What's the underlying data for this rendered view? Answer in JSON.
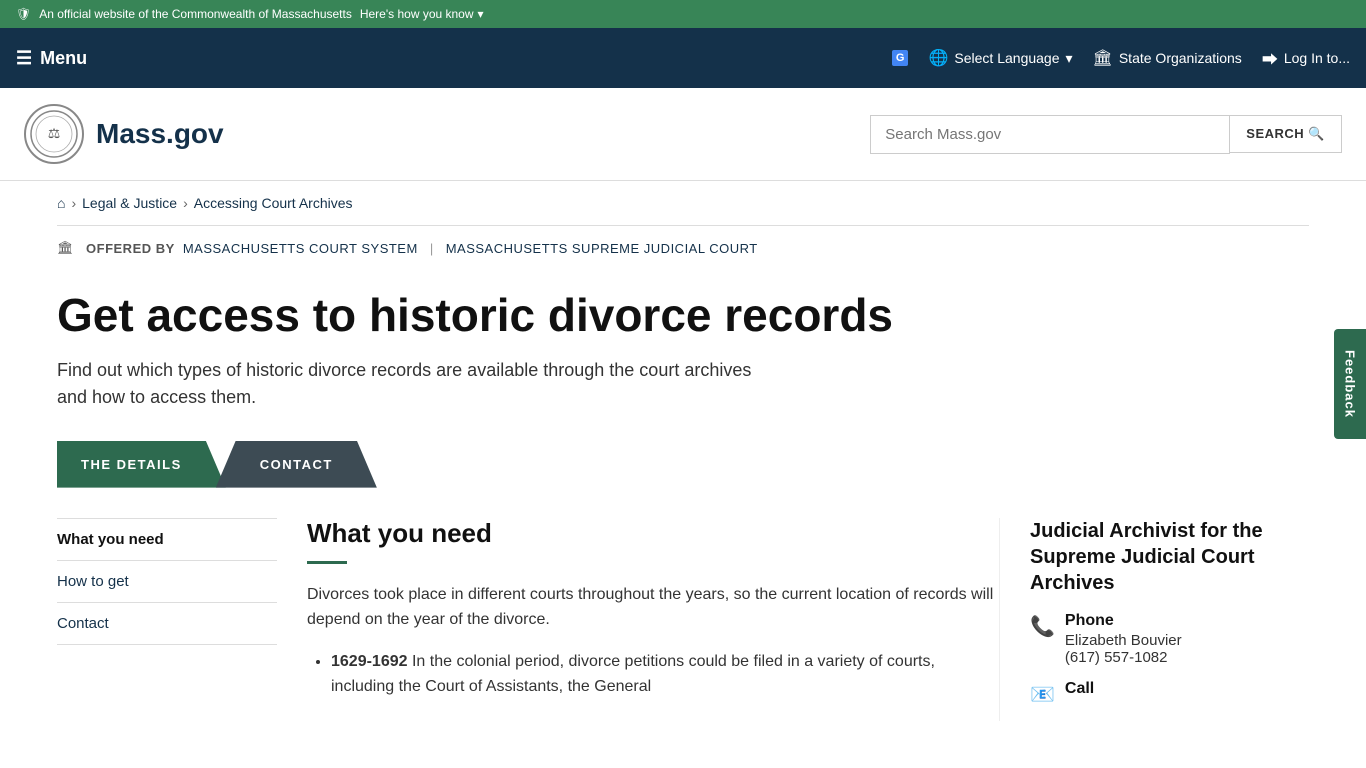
{
  "top_banner": {
    "text": "An official website of the Commonwealth of Massachusetts",
    "link_text": "Here's how you know",
    "shield": "🛡"
  },
  "nav": {
    "menu_label": "Menu",
    "hamburger": "☰",
    "translate_icon": "🌐",
    "select_language": "Select Language",
    "building_icon": "🏛",
    "state_organizations": "State Organizations",
    "login_icon": "→",
    "log_in": "Log In to..."
  },
  "header": {
    "logo_icon": "⚙",
    "logo_text": "Mass.gov",
    "search_placeholder": "Search Mass.gov",
    "search_label": "SEARCH"
  },
  "breadcrumb": {
    "home_icon": "⌂",
    "items": [
      {
        "label": "Legal & Justice",
        "url": "#"
      },
      {
        "label": "Accessing Court Archives",
        "url": "#"
      }
    ]
  },
  "offered_by": {
    "label": "OFFERED BY",
    "orgs": [
      {
        "label": "Massachusetts Court System",
        "url": "#"
      },
      {
        "label": "Massachusetts Supreme Judicial Court",
        "url": "#"
      }
    ]
  },
  "page": {
    "title": "Get access to historic divorce records",
    "subtitle": "Find out which types of historic divorce records are available through the court archives and how to access them."
  },
  "tabs": {
    "details": "THE DETAILS",
    "contact": "CONTACT"
  },
  "sidebar": {
    "links": [
      {
        "label": "What you need",
        "active": true
      },
      {
        "label": "How to get"
      },
      {
        "label": "Contact"
      }
    ]
  },
  "main_content": {
    "section_title": "What you need",
    "intro_text": "Divorces took place in different courts throughout the years, so the current location of records will depend on the year of the divorce.",
    "bullets": [
      {
        "range": "1629-1692",
        "text": "In the colonial period, divorce petitions could be filed in a variety of courts, including the Court of Assistants, the General"
      }
    ]
  },
  "contact_panel": {
    "title": "Judicial Archivist for the Supreme Judicial Court Archives",
    "phone_icon": "📞",
    "phone_label": "Phone",
    "phone_name": "Elizabeth Bouvier",
    "phone_number": "(617) 557-1082",
    "call_icon": "📧",
    "call_label": "Call"
  },
  "feedback": {
    "label": "Feedback"
  }
}
